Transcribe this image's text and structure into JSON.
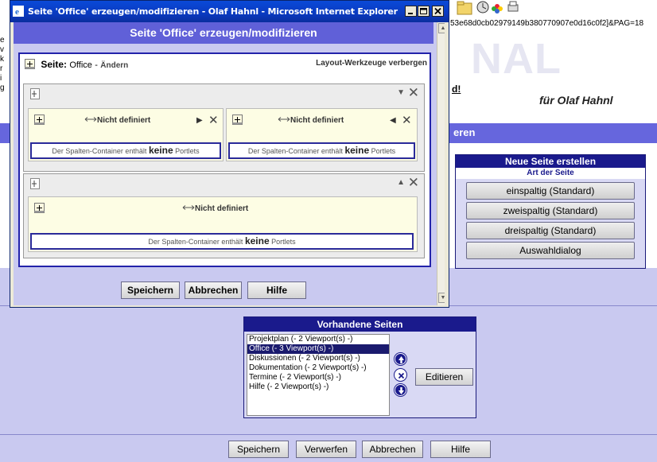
{
  "background": {
    "url_fragment": "53e68d0cb02979149b380770907e0d16c0f2]&PAG=18",
    "logo_text": "NAL",
    "greeting_fragment": "d!",
    "user_line": "für Olaf Hahnl",
    "section_title_fragment": "eren",
    "left_marks": [
      "e",
      "v",
      "k",
      "r",
      "i",
      "g"
    ]
  },
  "new_page": {
    "title": "Neue Seite erstellen",
    "subtitle": "Art der Seite",
    "buttons": [
      "einspaltig (Standard)",
      "zweispaltig (Standard)",
      "dreispaltig (Standard)",
      "Auswahldialog"
    ]
  },
  "existing_pages": {
    "title": "Vorhandene Seiten",
    "items": [
      "Projektplan (- 2  Viewport(s) -)",
      "Office (- 3  Viewport(s) -)",
      "Diskussionen (- 2  Viewport(s) -)",
      "Dokumentation (- 2  Viewport(s) -)",
      "Termine (- 2  Viewport(s) -)",
      "Hilfe (- 2  Viewport(s) -)"
    ],
    "selected_index": 1,
    "edit_label": "Editieren"
  },
  "bottom_buttons": {
    "save": "Speichern",
    "discard": "Verwerfen",
    "cancel": "Abbrechen",
    "help": "Hilfe"
  },
  "popup": {
    "window_title": "Seite 'Office' erzeugen/modifizieren - Olaf Hahnl - Microsoft Internet Explorer",
    "header": "Seite 'Office' erzeugen/modifizieren",
    "page_label": "Seite:",
    "page_name": "Office",
    "separator": "-",
    "edit_link": "Ändern",
    "layout_tools": "Layout-Werkzeuge verbergen",
    "undefined_label": "Nicht definiert",
    "empty_prefix": "Der Spalten-Container enthält ",
    "empty_keyword": "keine",
    "empty_suffix": " Portlets",
    "row1_arrow": "▼",
    "row2_arrow": "▲",
    "col1_arrow": "▶",
    "col2_arrow": "◀",
    "close_glyph": "✕",
    "buttons": {
      "save": "Speichern",
      "cancel": "Abbrechen",
      "help": "Hilfe"
    }
  }
}
